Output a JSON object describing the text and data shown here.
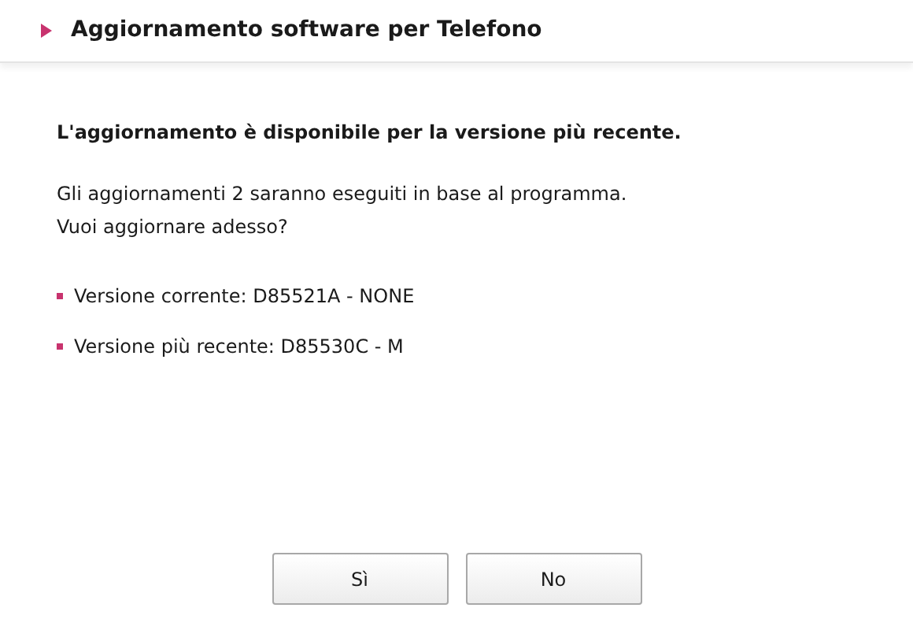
{
  "header": {
    "title": "Aggiornamento software per Telefono"
  },
  "headline": "L'aggiornamento è disponibile per la versione più recente.",
  "message_lines": [
    "Gli aggiornamenti 2 saranno eseguiti in base al programma.",
    "Vuoi aggiornare adesso?"
  ],
  "versions": [
    "Versione corrente: D85521A - NONE",
    "Versione più recente: D85530C - M"
  ],
  "buttons": [
    "Sì",
    "No"
  ]
}
